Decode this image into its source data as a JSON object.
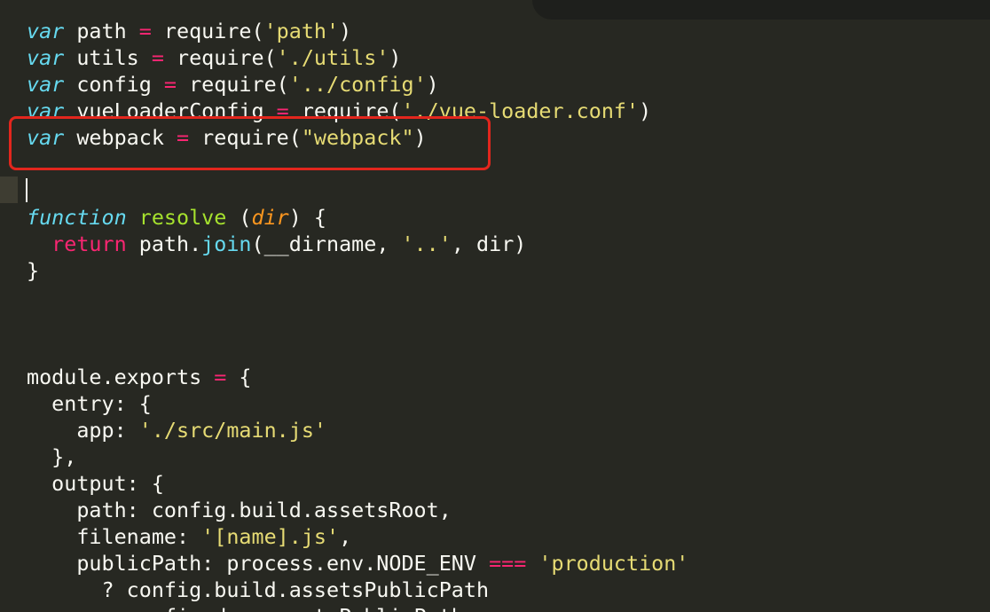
{
  "editor": {
    "lines": [
      [
        {
          "t": "var",
          "c": "kw-italic"
        },
        {
          "t": " path ",
          "c": "plain"
        },
        {
          "t": "=",
          "c": "op"
        },
        {
          "t": " require(",
          "c": "plain"
        },
        {
          "t": "'path'",
          "c": "str"
        },
        {
          "t": ")",
          "c": "plain"
        }
      ],
      [
        {
          "t": "var",
          "c": "kw-italic"
        },
        {
          "t": " utils ",
          "c": "plain"
        },
        {
          "t": "=",
          "c": "op"
        },
        {
          "t": " require(",
          "c": "plain"
        },
        {
          "t": "'./utils'",
          "c": "str"
        },
        {
          "t": ")",
          "c": "plain"
        }
      ],
      [
        {
          "t": "var",
          "c": "kw-italic"
        },
        {
          "t": " config ",
          "c": "plain"
        },
        {
          "t": "=",
          "c": "op"
        },
        {
          "t": " require(",
          "c": "plain"
        },
        {
          "t": "'../config'",
          "c": "str"
        },
        {
          "t": ")",
          "c": "plain"
        }
      ],
      [
        {
          "t": "var",
          "c": "kw-italic"
        },
        {
          "t": " vueLoaderConfig ",
          "c": "plain"
        },
        {
          "t": "=",
          "c": "op"
        },
        {
          "t": " require(",
          "c": "plain"
        },
        {
          "t": "'./vue-loader.conf'",
          "c": "str"
        },
        {
          "t": ")",
          "c": "plain"
        }
      ],
      [
        {
          "t": "var",
          "c": "kw-italic"
        },
        {
          "t": " webpack ",
          "c": "plain"
        },
        {
          "t": "=",
          "c": "op"
        },
        {
          "t": " require(",
          "c": "plain"
        },
        {
          "t": "\"webpack\"",
          "c": "str"
        },
        {
          "t": ")",
          "c": "plain"
        }
      ],
      [],
      [],
      [
        {
          "t": "function",
          "c": "kw-italic"
        },
        {
          "t": " ",
          "c": "plain"
        },
        {
          "t": "resolve",
          "c": "fn"
        },
        {
          "t": " (",
          "c": "plain"
        },
        {
          "t": "dir",
          "c": "param"
        },
        {
          "t": ") {",
          "c": "plain"
        }
      ],
      [
        {
          "t": "  ",
          "c": "plain"
        },
        {
          "t": "return",
          "c": "kw"
        },
        {
          "t": " path.",
          "c": "plain"
        },
        {
          "t": "join",
          "c": "builtin"
        },
        {
          "t": "(__dirname, ",
          "c": "plain"
        },
        {
          "t": "'..'",
          "c": "str"
        },
        {
          "t": ", dir)",
          "c": "plain"
        }
      ],
      [
        {
          "t": "}",
          "c": "plain"
        }
      ],
      [],
      [],
      [],
      [
        {
          "t": "module.exports ",
          "c": "plain"
        },
        {
          "t": "=",
          "c": "op"
        },
        {
          "t": " {",
          "c": "plain"
        }
      ],
      [
        {
          "t": "  entry: {",
          "c": "plain"
        }
      ],
      [
        {
          "t": "    app: ",
          "c": "plain"
        },
        {
          "t": "'./src/main.js'",
          "c": "str"
        }
      ],
      [
        {
          "t": "  },",
          "c": "plain"
        }
      ],
      [
        {
          "t": "  output: {",
          "c": "plain"
        }
      ],
      [
        {
          "t": "    path: config.build.assetsRoot,",
          "c": "plain"
        }
      ],
      [
        {
          "t": "    filename: ",
          "c": "plain"
        },
        {
          "t": "'[name].js'",
          "c": "str"
        },
        {
          "t": ",",
          "c": "plain"
        }
      ],
      [
        {
          "t": "    publicPath: process.env.NODE_ENV ",
          "c": "plain"
        },
        {
          "t": "===",
          "c": "op"
        },
        {
          "t": " ",
          "c": "plain"
        },
        {
          "t": "'production'",
          "c": "str"
        }
      ],
      [
        {
          "t": "      ? config.build.assetsPublicPath",
          "c": "plain"
        }
      ],
      [
        {
          "t": "      : config.dev.assetsPublicPath",
          "c": "plain"
        }
      ]
    ]
  },
  "colors": {
    "background": "#272822",
    "keyword": "#66d9ef",
    "operator": "#f92672",
    "string": "#e6db74",
    "function_name": "#a6e22e",
    "parameter": "#fd971f",
    "highlight_box": "#e2261d"
  }
}
